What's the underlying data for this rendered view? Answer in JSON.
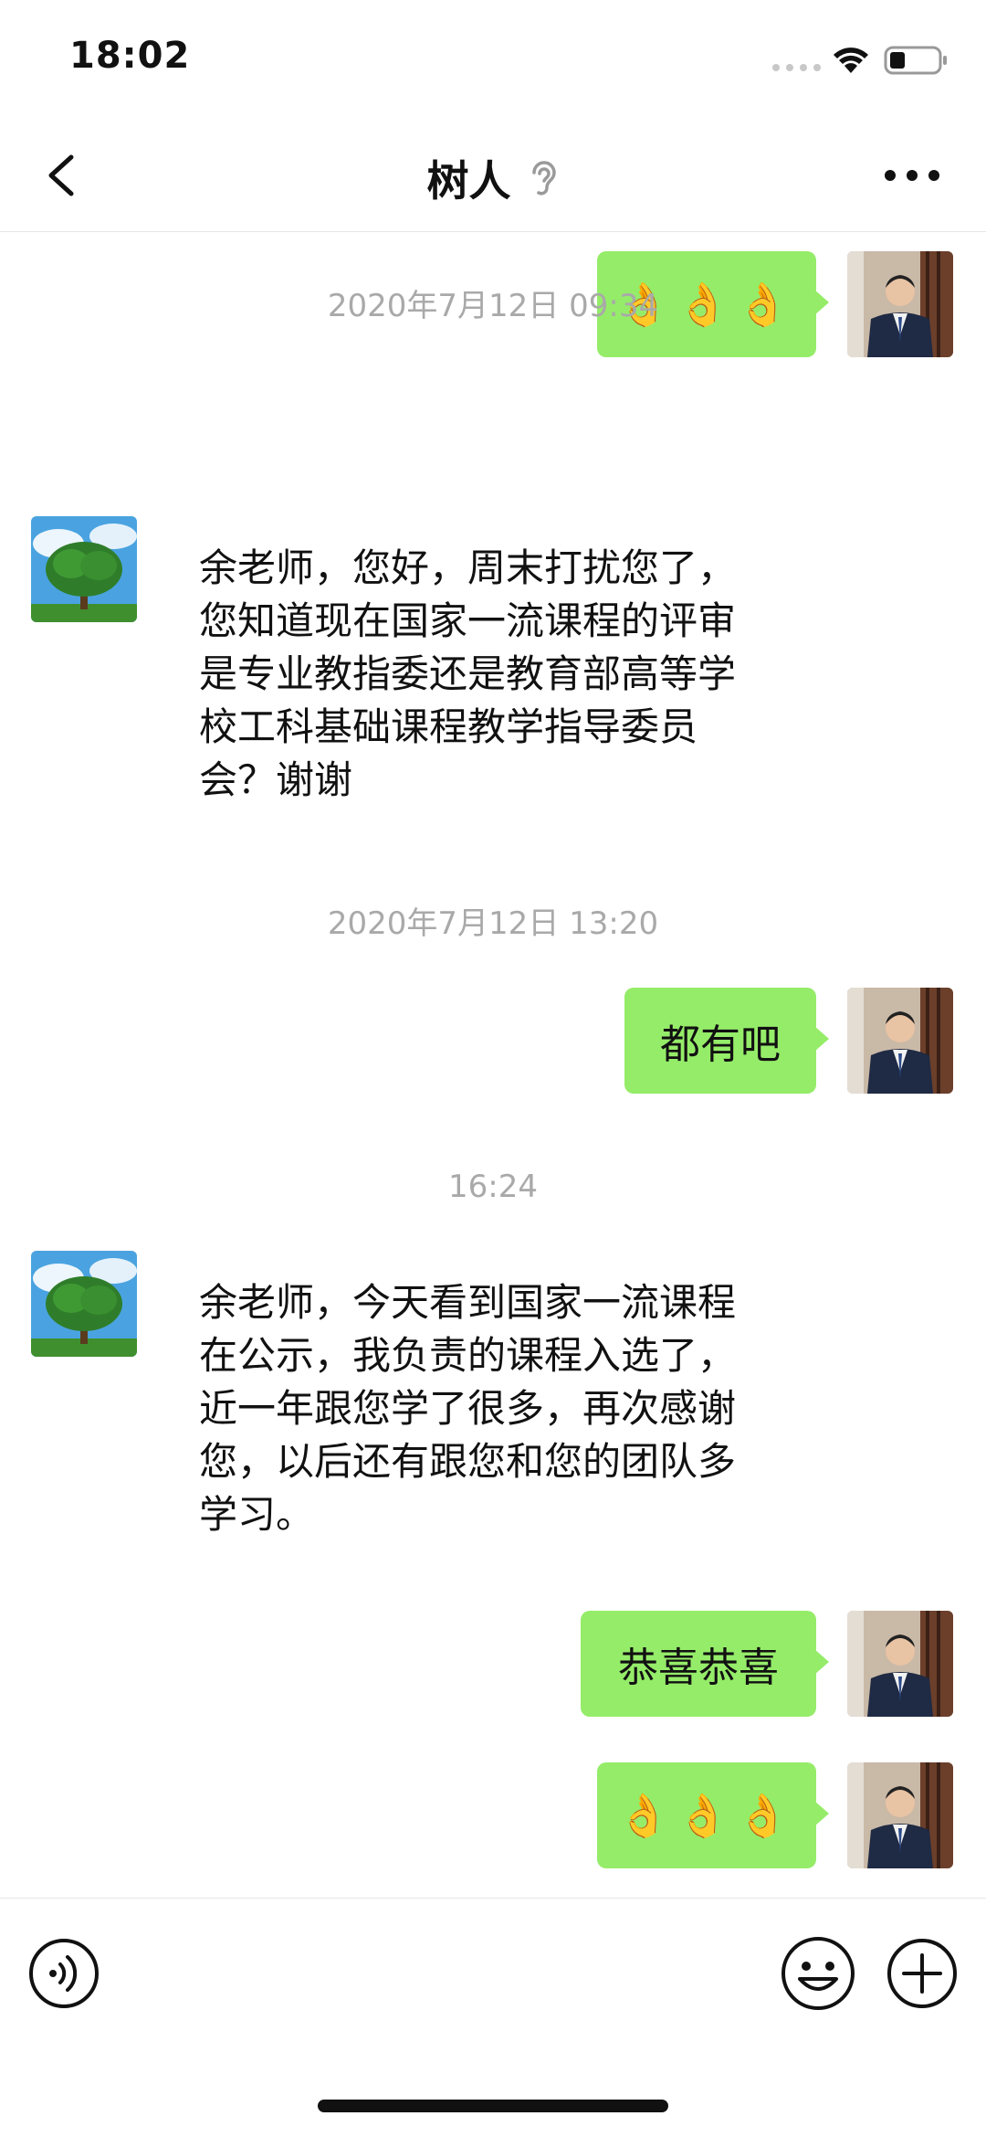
{
  "status_bar": {
    "time": "18:02"
  },
  "nav": {
    "title": "树人"
  },
  "messages": {
    "m1_emoji": "👌👌👌",
    "ts1": "2020年7月12日 09:34",
    "m2_text": "余老师，您好，周末打扰您了，\n您知道现在国家一流课程的评审\n是专业教指委还是教育部高等学\n校工科基础课程教学指导委员\n会？谢谢",
    "ts2": "2020年7月12日 13:20",
    "m3_text": "都有吧",
    "ts3": "16:24",
    "m4_text": "余老师，今天看到国家一流课程\n在公示，我负责的课程入选了，\n近一年跟您学了很多，再次感谢\n您，以后还有跟您和您的团队多\n学习。",
    "m5_text": "恭喜恭喜",
    "m6_emoji": "👌👌👌"
  },
  "colors": {
    "self_bubble": "#95ec69",
    "timestamp": "#a9a9a9"
  },
  "icons": {
    "back": "chevron-left-icon",
    "ear": "ear-icon",
    "more": "more-dots-icon",
    "voice": "voice-icon",
    "emoji": "emoji-icon",
    "plus": "plus-icon"
  }
}
